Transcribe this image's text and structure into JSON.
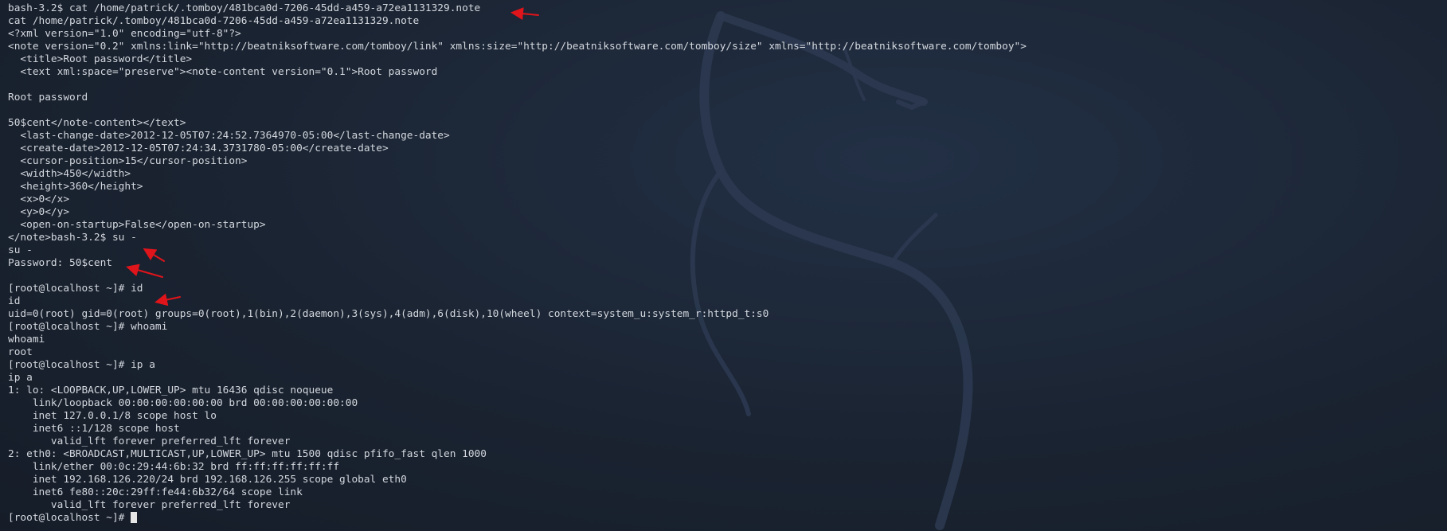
{
  "terminal": {
    "lines": [
      "bash-3.2$ cat /home/patrick/.tomboy/481bca0d-7206-45dd-a459-a72ea1131329.note",
      "cat /home/patrick/.tomboy/481bca0d-7206-45dd-a459-a72ea1131329.note",
      "<?xml version=\"1.0\" encoding=\"utf-8\"?>",
      "<note version=\"0.2\" xmlns:link=\"http://beatniksoftware.com/tomboy/link\" xmlns:size=\"http://beatniksoftware.com/tomboy/size\" xmlns=\"http://beatniksoftware.com/tomboy\">",
      "  <title>Root password</title>",
      "  <text xml:space=\"preserve\"><note-content version=\"0.1\">Root password",
      "",
      "Root password",
      "",
      "50$cent</note-content></text>",
      "  <last-change-date>2012-12-05T07:24:52.7364970-05:00</last-change-date>",
      "  <create-date>2012-12-05T07:24:34.3731780-05:00</create-date>",
      "  <cursor-position>15</cursor-position>",
      "  <width>450</width>",
      "  <height>360</height>",
      "  <x>0</x>",
      "  <y>0</y>",
      "  <open-on-startup>False</open-on-startup>",
      "</note>bash-3.2$ su -",
      "su -",
      "Password: 50$cent",
      "",
      "[root@localhost ~]# id",
      "id",
      "uid=0(root) gid=0(root) groups=0(root),1(bin),2(daemon),3(sys),4(adm),6(disk),10(wheel) context=system_u:system_r:httpd_t:s0",
      "[root@localhost ~]# whoami",
      "whoami",
      "root",
      "[root@localhost ~]# ip a",
      "ip a",
      "1: lo: <LOOPBACK,UP,LOWER_UP> mtu 16436 qdisc noqueue",
      "    link/loopback 00:00:00:00:00:00 brd 00:00:00:00:00:00",
      "    inet 127.0.0.1/8 scope host lo",
      "    inet6 ::1/128 scope host",
      "       valid_lft forever preferred_lft forever",
      "2: eth0: <BROADCAST,MULTICAST,UP,LOWER_UP> mtu 1500 qdisc pfifo_fast qlen 1000",
      "    link/ether 00:0c:29:44:6b:32 brd ff:ff:ff:ff:ff:ff",
      "    inet 192.168.126.220/24 brd 192.168.126.255 scope global eth0",
      "    inet6 fe80::20c:29ff:fe44:6b32/64 scope link",
      "       valid_lft forever preferred_lft forever"
    ],
    "prompt": "[root@localhost ~]# "
  },
  "colors": {
    "background": "#1b2330",
    "text": "#d4d8de",
    "annotation_arrow": "#e0141b",
    "cursor": "#e6e6e6"
  },
  "icons": {
    "wallpaper": "kali-dragon-icon",
    "annotation": "red-arrow-icon"
  }
}
